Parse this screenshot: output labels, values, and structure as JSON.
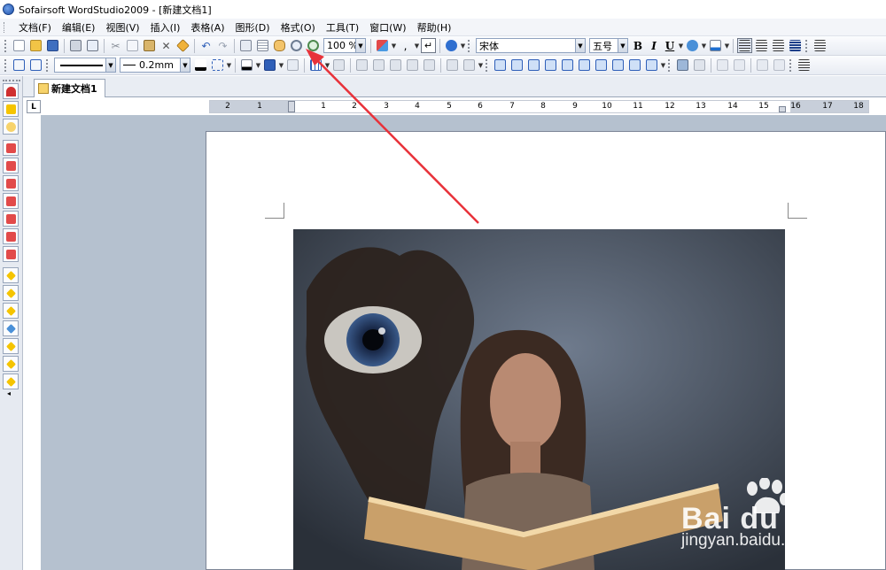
{
  "window": {
    "title": "Sofairsoft WordStudio2009 - [新建文档1]"
  },
  "menu": {
    "items": [
      "文档(F)",
      "编辑(E)",
      "视图(V)",
      "插入(I)",
      "表格(A)",
      "图形(D)",
      "格式(O)",
      "工具(T)",
      "窗口(W)",
      "帮助(H)"
    ]
  },
  "toolbar1": {
    "zoom_value": "100 %",
    "font_name": "宋体",
    "font_size": "五号",
    "bold_label": "B",
    "italic_label": "I",
    "underline_label": "U"
  },
  "toolbar2": {
    "line_width_value": "0.2mm"
  },
  "tabs": {
    "document_tab": "新建文档1"
  },
  "ruler": {
    "corner_label": "L",
    "numbers": [
      "2",
      "1",
      "1",
      "2",
      "3",
      "4",
      "5",
      "6",
      "7",
      "8",
      "9",
      "10",
      "11",
      "12",
      "13",
      "14",
      "15",
      "16",
      "17",
      "18"
    ]
  },
  "watermark": {
    "brand": "Bai du 经验",
    "url": "jingyan.baidu.com"
  },
  "colors": {
    "annotation_arrow": "#e8323a",
    "workspace_bg": "#b5c1cf",
    "toolbar_bg": "#e8ecf3"
  }
}
